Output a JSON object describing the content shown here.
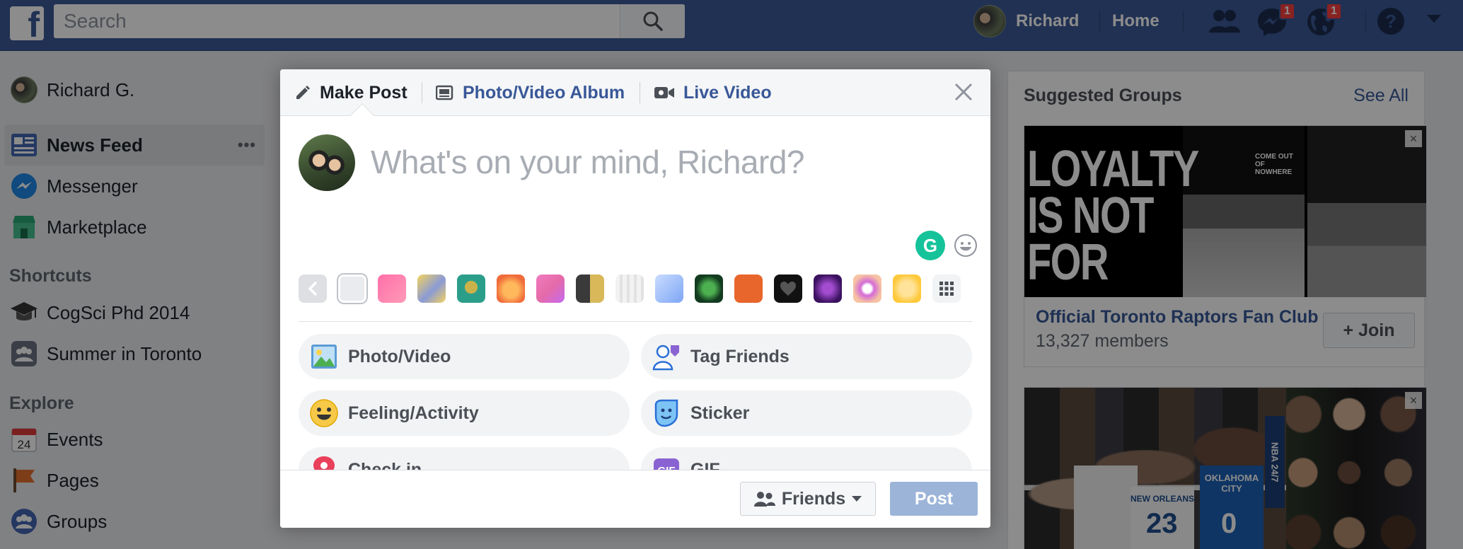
{
  "topbar": {
    "logo": "f",
    "search_placeholder": "Search",
    "profile_name": "Richard",
    "home_label": "Home",
    "messages_badge": "1",
    "notifications_badge": "1"
  },
  "sidebar": {
    "profile_name": "Richard G.",
    "items": [
      {
        "label": "News Feed",
        "icon": "news-feed-icon"
      },
      {
        "label": "Messenger",
        "icon": "messenger-icon"
      },
      {
        "label": "Marketplace",
        "icon": "marketplace-icon"
      }
    ],
    "more_glyph": "•••",
    "shortcuts_heading": "Shortcuts",
    "shortcuts": [
      {
        "label": "CogSci Phd 2014"
      },
      {
        "label": "Summer in Toronto"
      }
    ],
    "explore_heading": "Explore",
    "explore": [
      {
        "label": "Events",
        "date_num": "24"
      },
      {
        "label": "Pages"
      },
      {
        "label": "Groups"
      }
    ]
  },
  "suggested_groups": {
    "title": "Suggested Groups",
    "see_all": "See All",
    "card1": {
      "image_text": "LOYALTY IS NOT FOR",
      "image_tagline": "COME OUT OF NOWHERE",
      "name": "Official Toronto Raptors Fan Club",
      "members": "13,327 members",
      "join_label": "+ Join"
    },
    "card2": {
      "jersey_left": "23",
      "jersey_right": "0",
      "jersey_text": "NEW ORLEANS",
      "jersey_text_2": "OKLAHOMA CITY",
      "badge_text": "NBA 24/7"
    }
  },
  "composer": {
    "tabs": [
      {
        "label": "Make Post",
        "icon": "pencil-icon"
      },
      {
        "label": "Photo/Video Album",
        "icon": "album-icon"
      },
      {
        "label": "Live Video",
        "icon": "video-camera-icon"
      }
    ],
    "placeholder": "What's on your mind, Richard?",
    "grammarly_letter": "G",
    "options": [
      {
        "label": "Photo/Video",
        "icon": "photo-icon"
      },
      {
        "label": "Tag Friends",
        "icon": "tag-friends-icon"
      },
      {
        "label": "Feeling/Activity",
        "icon": "feeling-icon"
      },
      {
        "label": "Sticker",
        "icon": "sticker-icon"
      },
      {
        "label": "Check in",
        "icon": "check-in-icon"
      },
      {
        "label": "GIF",
        "icon": "gif-icon"
      }
    ],
    "audience_label": "Friends",
    "post_label": "Post"
  },
  "colors": {
    "brand": "#3b5998",
    "link": "#385898",
    "post_disabled": "#9cb4d8"
  }
}
